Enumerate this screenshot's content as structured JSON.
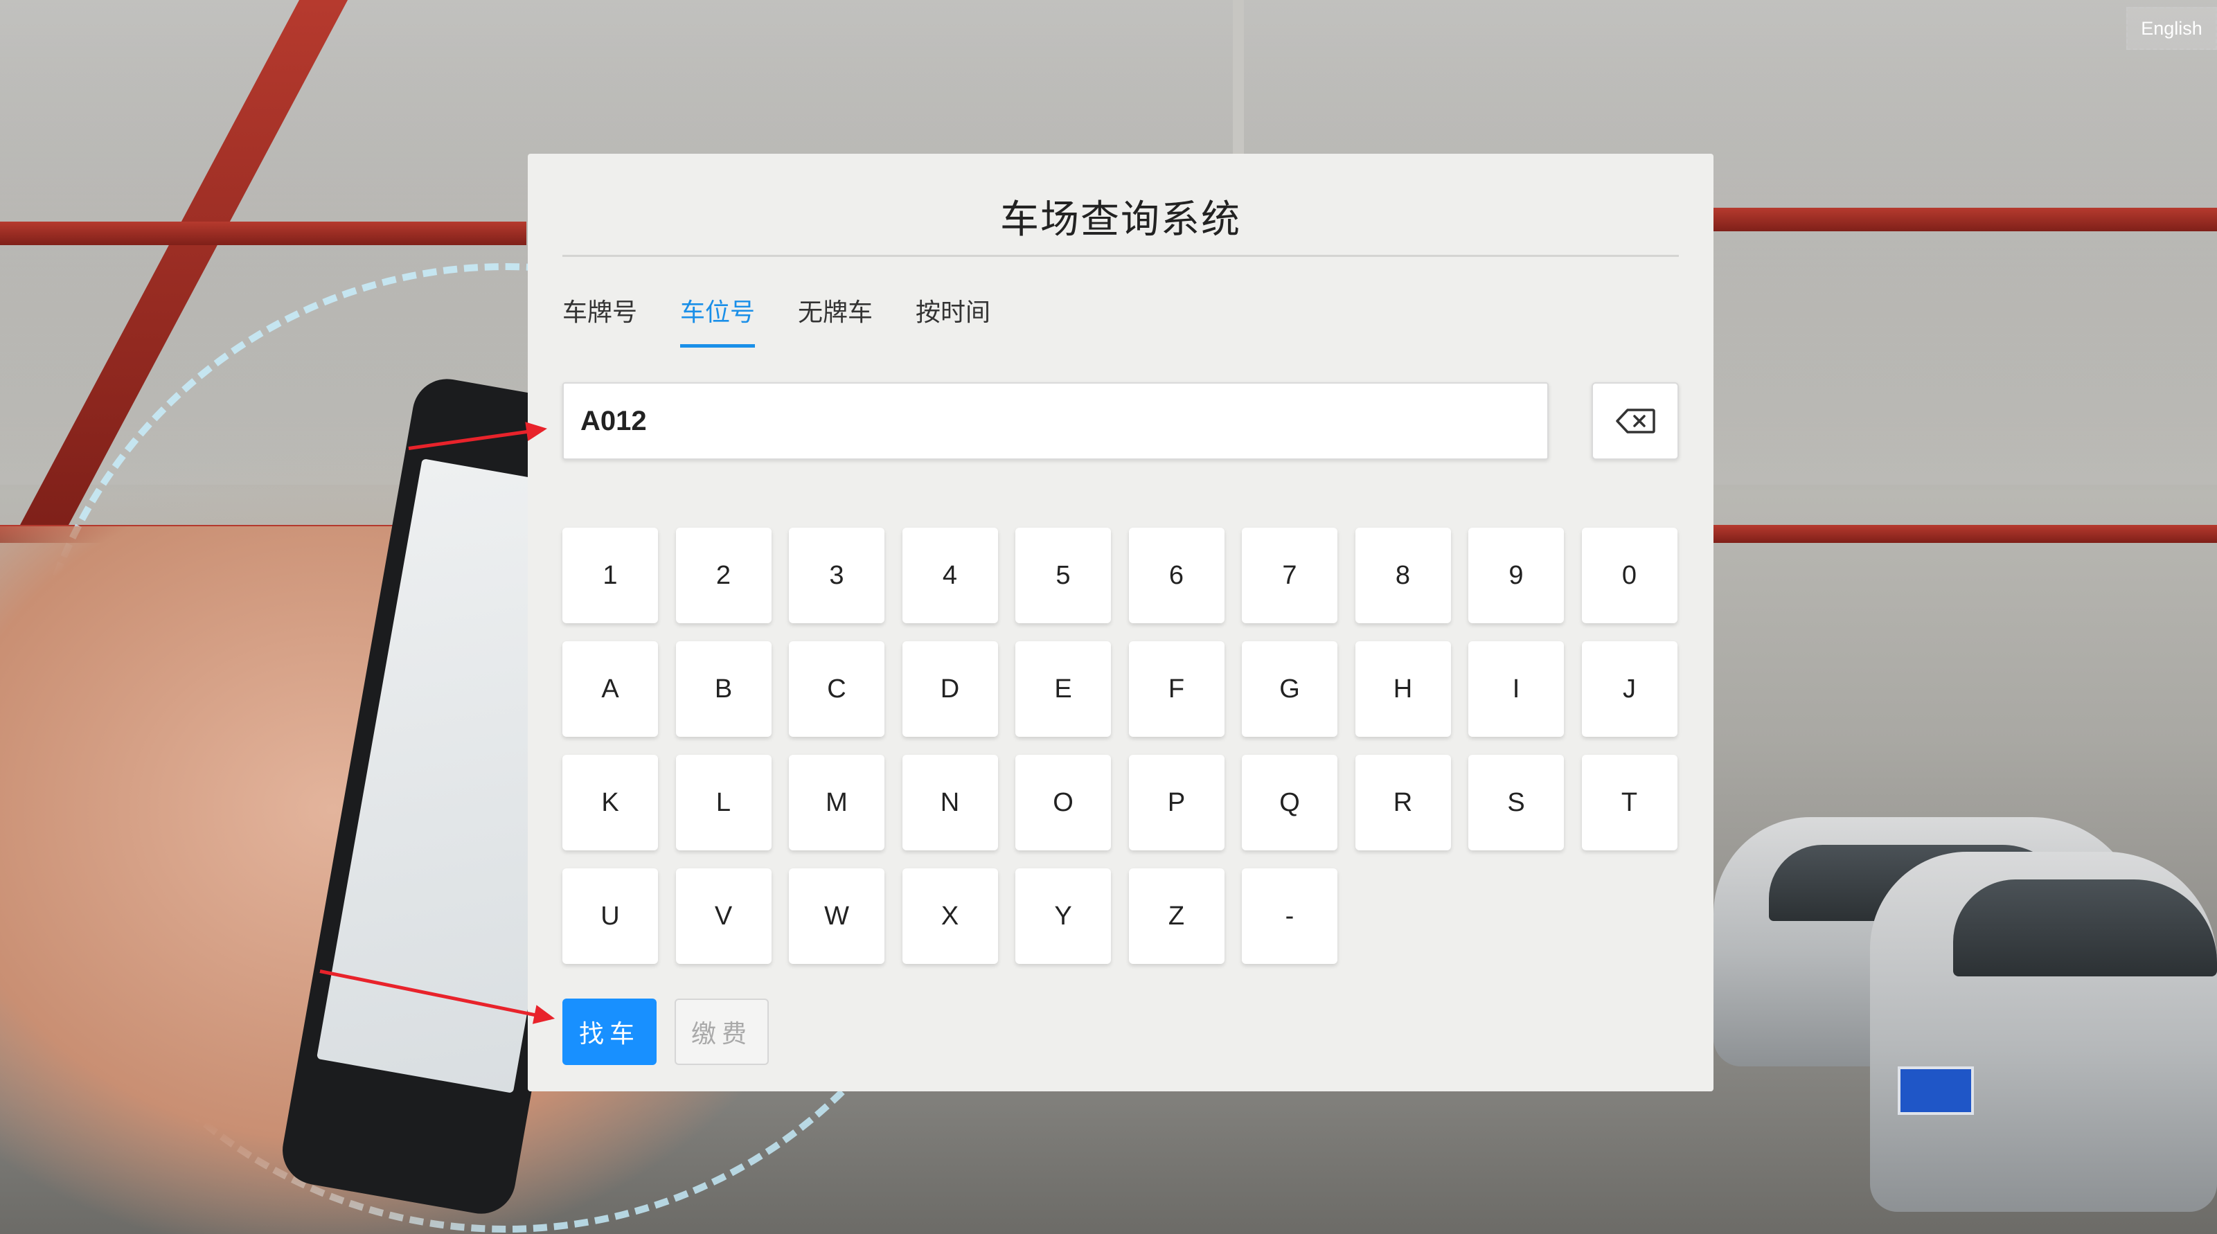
{
  "header": {
    "language_button": "English"
  },
  "panel": {
    "title": "车场查询系统",
    "tabs": [
      {
        "label": "车牌号",
        "active": false
      },
      {
        "label": "车位号",
        "active": true
      },
      {
        "label": "无牌车",
        "active": false
      },
      {
        "label": "按时间",
        "active": false
      }
    ],
    "input": {
      "value": "A012"
    },
    "backspace_icon": "backspace-icon"
  },
  "keyboard": {
    "rows": [
      [
        "1",
        "2",
        "3",
        "4",
        "5",
        "6",
        "7",
        "8",
        "9",
        "0"
      ],
      [
        "A",
        "B",
        "C",
        "D",
        "E",
        "F",
        "G",
        "H",
        "I",
        "J"
      ],
      [
        "K",
        "L",
        "M",
        "N",
        "O",
        "P",
        "Q",
        "R",
        "S",
        "T"
      ],
      [
        "U",
        "V",
        "W",
        "X",
        "Y",
        "Z",
        "-"
      ]
    ]
  },
  "actions": {
    "find_label": "找车",
    "pay_label": "缴费"
  },
  "colors": {
    "accent": "#1890ff",
    "arrow": "#e8232b"
  }
}
